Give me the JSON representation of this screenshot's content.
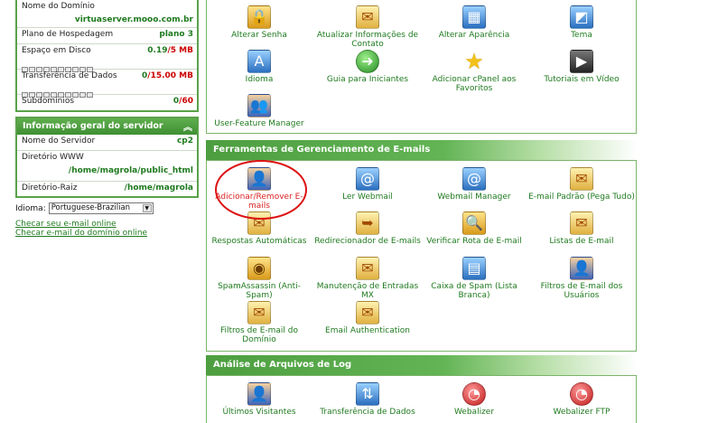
{
  "sidebar": {
    "domain": {
      "label": "Nome do Domínio",
      "value": "virtuaserver.mooo.com.br"
    },
    "plan": {
      "label": "Plano de Hospedagem",
      "value": "plano 3"
    },
    "disk": {
      "label": "Espaço em Disco",
      "used": "0.19",
      "sep": "/",
      "total": "5 MB"
    },
    "transfer": {
      "label": "Transferência de Dados",
      "used": "0",
      "sep": "/",
      "total": "15.00 MB"
    },
    "subdomains": {
      "label": "Subdomínios",
      "used": "0",
      "sep": "/",
      "total": "60"
    },
    "server_header": "Informação geral do servidor",
    "server_name": {
      "label": "Nome do Servidor",
      "value": "cp2"
    },
    "www_dir": {
      "label": "Diretório WWW",
      "value": "/home/magrola/public_html"
    },
    "root_dir": {
      "label": "Diretório-Raiz",
      "value": "/home/magrola"
    },
    "language": {
      "label": "Idioma:",
      "selected": "Portuguese-Brazilian"
    },
    "links": [
      "Checar seu e-mail online",
      "Checar e-mail do domínio online"
    ]
  },
  "preferences": {
    "items": [
      {
        "label": "Alterar Senha",
        "icon": "lock-icon"
      },
      {
        "label": "Atualizar Informações de Contato",
        "icon": "contact-envelope-icon"
      },
      {
        "label": "Alterar Aparência",
        "icon": "appearance-icon"
      },
      {
        "label": "Tema",
        "icon": "theme-icon"
      },
      {
        "label": "Idioma",
        "icon": "language-icon"
      },
      {
        "label": "Guia para Iniciantes",
        "icon": "arrow-guide-icon"
      },
      {
        "label": "Adicionar cPanel aos Favoritos",
        "icon": "star-icon"
      },
      {
        "label": "Tutoriais em Vídeo",
        "icon": "video-icon"
      },
      {
        "label": "User-Feature Manager",
        "icon": "users-icon"
      }
    ]
  },
  "email": {
    "title": "Ferramentas de Gerenciamento de E-mails",
    "items": [
      {
        "label": "Adicionar/Remover E-mails",
        "icon": "person-mail-icon"
      },
      {
        "label": "Ler Webmail",
        "icon": "webmail-icon"
      },
      {
        "label": "Webmail Manager",
        "icon": "webmail-manager-icon"
      },
      {
        "label": "E-mail Padrão (Pega Tudo)",
        "icon": "default-mail-icon"
      },
      {
        "label": "Respostas Automáticas",
        "icon": "auto-reply-icon"
      },
      {
        "label": "Redirecionador de E-mails",
        "icon": "forwarder-icon"
      },
      {
        "label": "Verificar Rota de E-mail",
        "icon": "magnifier-icon"
      },
      {
        "label": "Listas de E-mail",
        "icon": "mailing-list-icon"
      },
      {
        "label": "SpamAssassin (Anti-Spam)",
        "icon": "spam-icon"
      },
      {
        "label": "Manutenção de Entradas MX",
        "icon": "mx-icon"
      },
      {
        "label": "Caixa de Spam (Lista Branca)",
        "icon": "spam-box-icon"
      },
      {
        "label": "Filtros de E-mail dos Usuários",
        "icon": "user-filter-icon"
      },
      {
        "label": "Filtros de E-mail do Domínio",
        "icon": "domain-filter-icon"
      },
      {
        "label": "Email Authentication",
        "icon": "auth-icon"
      }
    ]
  },
  "logs": {
    "title": "Análise de Arquivos de Log",
    "items": [
      {
        "label": "Últimos Visitantes",
        "icon": "visitor-icon"
      },
      {
        "label": "Transferência de Dados",
        "icon": "transfer-icon"
      },
      {
        "label": "Webalizer",
        "icon": "webalizer-icon"
      },
      {
        "label": "Webalizer FTP",
        "icon": "webalizer-ftp-icon"
      }
    ]
  }
}
